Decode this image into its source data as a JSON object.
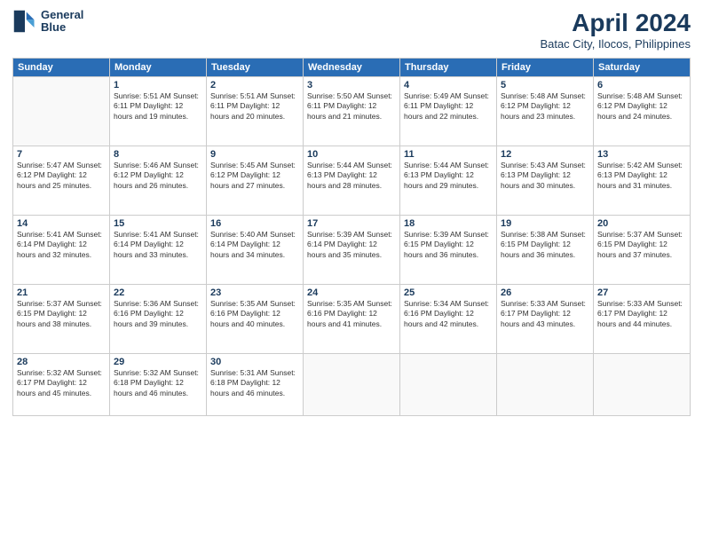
{
  "logo": {
    "line1": "General",
    "line2": "Blue"
  },
  "title": "April 2024",
  "location": "Batac City, Ilocos, Philippines",
  "headers": [
    "Sunday",
    "Monday",
    "Tuesday",
    "Wednesday",
    "Thursday",
    "Friday",
    "Saturday"
  ],
  "weeks": [
    [
      {
        "day": "",
        "info": ""
      },
      {
        "day": "1",
        "info": "Sunrise: 5:51 AM\nSunset: 6:11 PM\nDaylight: 12 hours\nand 19 minutes."
      },
      {
        "day": "2",
        "info": "Sunrise: 5:51 AM\nSunset: 6:11 PM\nDaylight: 12 hours\nand 20 minutes."
      },
      {
        "day": "3",
        "info": "Sunrise: 5:50 AM\nSunset: 6:11 PM\nDaylight: 12 hours\nand 21 minutes."
      },
      {
        "day": "4",
        "info": "Sunrise: 5:49 AM\nSunset: 6:11 PM\nDaylight: 12 hours\nand 22 minutes."
      },
      {
        "day": "5",
        "info": "Sunrise: 5:48 AM\nSunset: 6:12 PM\nDaylight: 12 hours\nand 23 minutes."
      },
      {
        "day": "6",
        "info": "Sunrise: 5:48 AM\nSunset: 6:12 PM\nDaylight: 12 hours\nand 24 minutes."
      }
    ],
    [
      {
        "day": "7",
        "info": "Sunrise: 5:47 AM\nSunset: 6:12 PM\nDaylight: 12 hours\nand 25 minutes."
      },
      {
        "day": "8",
        "info": "Sunrise: 5:46 AM\nSunset: 6:12 PM\nDaylight: 12 hours\nand 26 minutes."
      },
      {
        "day": "9",
        "info": "Sunrise: 5:45 AM\nSunset: 6:12 PM\nDaylight: 12 hours\nand 27 minutes."
      },
      {
        "day": "10",
        "info": "Sunrise: 5:44 AM\nSunset: 6:13 PM\nDaylight: 12 hours\nand 28 minutes."
      },
      {
        "day": "11",
        "info": "Sunrise: 5:44 AM\nSunset: 6:13 PM\nDaylight: 12 hours\nand 29 minutes."
      },
      {
        "day": "12",
        "info": "Sunrise: 5:43 AM\nSunset: 6:13 PM\nDaylight: 12 hours\nand 30 minutes."
      },
      {
        "day": "13",
        "info": "Sunrise: 5:42 AM\nSunset: 6:13 PM\nDaylight: 12 hours\nand 31 minutes."
      }
    ],
    [
      {
        "day": "14",
        "info": "Sunrise: 5:41 AM\nSunset: 6:14 PM\nDaylight: 12 hours\nand 32 minutes."
      },
      {
        "day": "15",
        "info": "Sunrise: 5:41 AM\nSunset: 6:14 PM\nDaylight: 12 hours\nand 33 minutes."
      },
      {
        "day": "16",
        "info": "Sunrise: 5:40 AM\nSunset: 6:14 PM\nDaylight: 12 hours\nand 34 minutes."
      },
      {
        "day": "17",
        "info": "Sunrise: 5:39 AM\nSunset: 6:14 PM\nDaylight: 12 hours\nand 35 minutes."
      },
      {
        "day": "18",
        "info": "Sunrise: 5:39 AM\nSunset: 6:15 PM\nDaylight: 12 hours\nand 36 minutes."
      },
      {
        "day": "19",
        "info": "Sunrise: 5:38 AM\nSunset: 6:15 PM\nDaylight: 12 hours\nand 36 minutes."
      },
      {
        "day": "20",
        "info": "Sunrise: 5:37 AM\nSunset: 6:15 PM\nDaylight: 12 hours\nand 37 minutes."
      }
    ],
    [
      {
        "day": "21",
        "info": "Sunrise: 5:37 AM\nSunset: 6:15 PM\nDaylight: 12 hours\nand 38 minutes."
      },
      {
        "day": "22",
        "info": "Sunrise: 5:36 AM\nSunset: 6:16 PM\nDaylight: 12 hours\nand 39 minutes."
      },
      {
        "day": "23",
        "info": "Sunrise: 5:35 AM\nSunset: 6:16 PM\nDaylight: 12 hours\nand 40 minutes."
      },
      {
        "day": "24",
        "info": "Sunrise: 5:35 AM\nSunset: 6:16 PM\nDaylight: 12 hours\nand 41 minutes."
      },
      {
        "day": "25",
        "info": "Sunrise: 5:34 AM\nSunset: 6:16 PM\nDaylight: 12 hours\nand 42 minutes."
      },
      {
        "day": "26",
        "info": "Sunrise: 5:33 AM\nSunset: 6:17 PM\nDaylight: 12 hours\nand 43 minutes."
      },
      {
        "day": "27",
        "info": "Sunrise: 5:33 AM\nSunset: 6:17 PM\nDaylight: 12 hours\nand 44 minutes."
      }
    ],
    [
      {
        "day": "28",
        "info": "Sunrise: 5:32 AM\nSunset: 6:17 PM\nDaylight: 12 hours\nand 45 minutes."
      },
      {
        "day": "29",
        "info": "Sunrise: 5:32 AM\nSunset: 6:18 PM\nDaylight: 12 hours\nand 46 minutes."
      },
      {
        "day": "30",
        "info": "Sunrise: 5:31 AM\nSunset: 6:18 PM\nDaylight: 12 hours\nand 46 minutes."
      },
      {
        "day": "",
        "info": ""
      },
      {
        "day": "",
        "info": ""
      },
      {
        "day": "",
        "info": ""
      },
      {
        "day": "",
        "info": ""
      }
    ]
  ]
}
